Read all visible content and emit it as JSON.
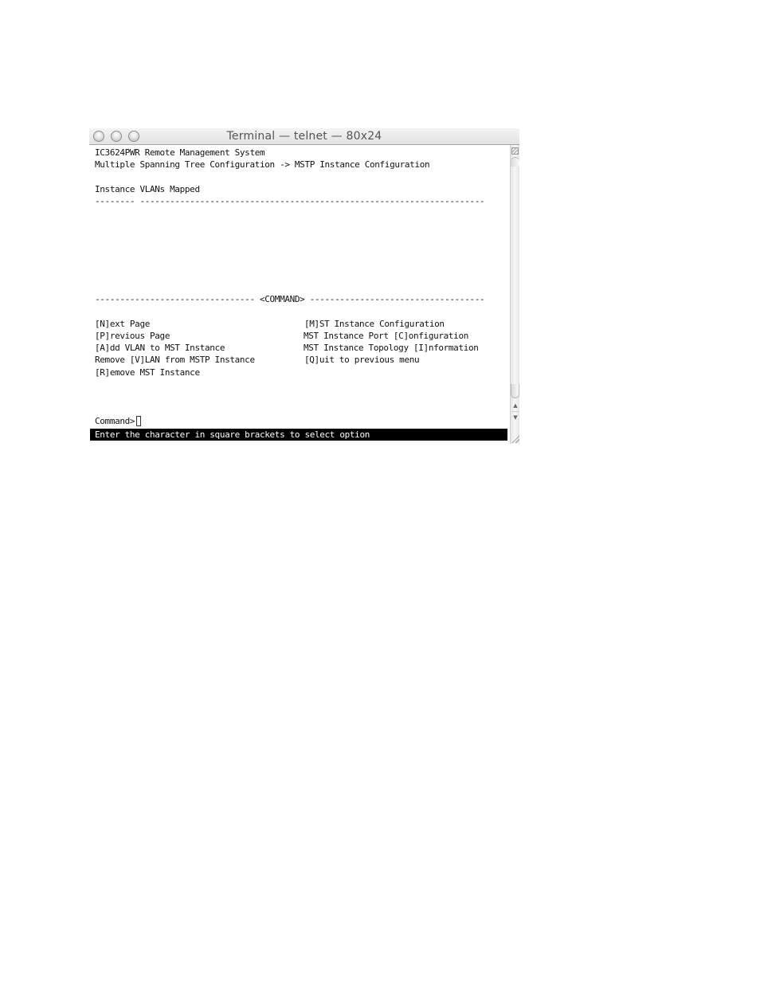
{
  "window": {
    "title": "Terminal — telnet — 80x24"
  },
  "terminal": {
    "header_line1": "IC3624PWR Remote Management System",
    "header_line2": "Multiple Spanning Tree Configuration -> MSTP Instance Configuration",
    "table_header": "Instance VLANs Mapped",
    "table_rule": "-------- ---------------------------------------------------------------------",
    "command_rule": "-------------------------------- <COMMAND> -----------------------------------",
    "menu_left": [
      "[N]ext Page",
      "[P]revious Page",
      "[A]dd VLAN to MST Instance",
      "Remove [V]LAN from MSTP Instance",
      "[R]emove MST Instance"
    ],
    "menu_right": [
      "[M]ST Instance Configuration",
      "MST Instance Port [C]onfiguration",
      "MST Instance Topology [I]nformation",
      "[Q]uit to previous menu"
    ],
    "prompt": "Command>",
    "input_value": "",
    "status_bar": "Enter the character in square brackets to select option"
  },
  "icons": {
    "close": "close-button-icon",
    "minimize": "minimize-button-icon",
    "zoom": "zoom-button-icon",
    "scroll_up": "▲",
    "scroll_down": "▼"
  }
}
